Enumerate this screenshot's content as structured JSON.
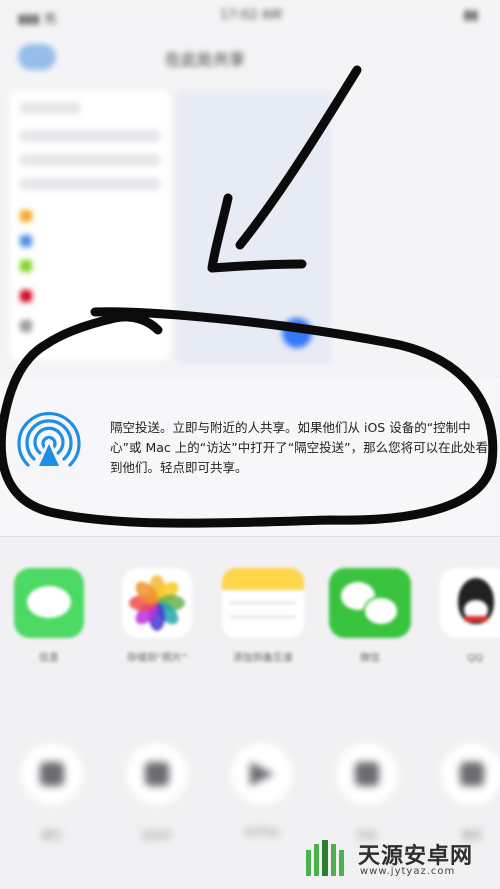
{
  "status_bar": {
    "left": "▮▮▮ 充",
    "center": "17:02 AM",
    "right": "▮▮"
  },
  "nav": {
    "back_label": "",
    "title": "在此处共享"
  },
  "airdrop": {
    "icon": "airdrop-icon",
    "description": "隔空投送。立即与附近的人共享。如果他们从 iOS 设备的“控制中心”或 Mac 上的“访达”中打开了“隔空投送”，那么您将可以在此处看到他们。轻点即可共享。"
  },
  "apps": [
    {
      "label": "信息",
      "icon": "messages-icon",
      "color": "#4cd964"
    },
    {
      "label": "存储到“照片”",
      "icon": "photos-icon",
      "color": "#ffffff"
    },
    {
      "label": "添加到备忘录",
      "icon": "notes-icon",
      "color": "#ffffff"
    },
    {
      "label": "微信",
      "icon": "wechat-icon",
      "color": "#39c33f"
    },
    {
      "label": "QQ",
      "icon": "qq-icon",
      "color": "#ffffff"
    }
  ],
  "actions": [
    {
      "label": "拷贝",
      "icon": "copy-icon"
    },
    {
      "label": "幻灯片",
      "icon": "slideshow-icon"
    },
    {
      "label": "AirPlay",
      "icon": "airplay-icon"
    },
    {
      "label": "打印",
      "icon": "print-icon"
    },
    {
      "label": "更多",
      "icon": "more-icon"
    }
  ],
  "watermark": {
    "title": "天源安卓网",
    "url": "www.jytyaz.com"
  },
  "colors": {
    "airdrop_blue": "#1e8fe6",
    "annotation_ink": "#0b0b0b",
    "accent": "#3478f6"
  }
}
